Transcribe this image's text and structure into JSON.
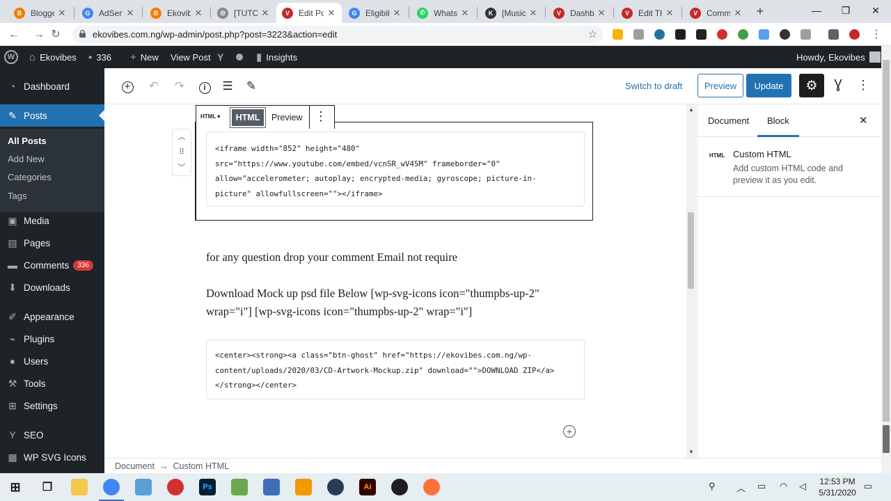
{
  "browser": {
    "tabs": [
      {
        "label": "Blogger",
        "color": "#f57c00",
        "glyph": "B"
      },
      {
        "label": "AdSense",
        "color": "#4285f4",
        "glyph": "G"
      },
      {
        "label": "Ekovibes",
        "color": "#f57c00",
        "glyph": "B"
      },
      {
        "label": "[TUTORIAL]",
        "color": "#888888",
        "glyph": "◎"
      },
      {
        "label": "Edit Post",
        "color": "#c62828",
        "glyph": "V"
      },
      {
        "label": "Eligibility",
        "color": "#4285f4",
        "glyph": "G"
      },
      {
        "label": "WhatsApp",
        "color": "#25d366",
        "glyph": "✆"
      },
      {
        "label": "[Music]",
        "color": "#333333",
        "glyph": "K"
      },
      {
        "label": "Dashboard",
        "color": "#c62828",
        "glyph": "V"
      },
      {
        "label": "Edit Theme",
        "color": "#c62828",
        "glyph": "V"
      },
      {
        "label": "Comments",
        "color": "#c62828",
        "glyph": "V"
      }
    ],
    "active_tab_index": 4,
    "url": "ekovibes.com.ng/wp-admin/post.php?post=3223&action=edit"
  },
  "adminbar": {
    "site_name": "Ekovibes",
    "comments_count": "336",
    "new_label": "New",
    "view_post_label": "View Post",
    "insights_label": "Insights",
    "howdy": "Howdy, Ekovibes"
  },
  "menu": {
    "dashboard": "Dashboard",
    "posts": "Posts",
    "sub": {
      "all": "All Posts",
      "add": "Add New",
      "cats": "Categories",
      "tags": "Tags"
    },
    "media": "Media",
    "pages": "Pages",
    "comments": "Comments",
    "comments_badge": "336",
    "downloads": "Downloads",
    "appearance": "Appearance",
    "plugins": "Plugins",
    "users": "Users",
    "tools": "Tools",
    "settings": "Settings",
    "seo": "SEO",
    "wpsvg": "WP SVG Icons"
  },
  "editor": {
    "switch_to_draft": "Switch to draft",
    "preview": "Preview",
    "update": "Update",
    "block_type_short": "HTML ▾",
    "html_tab": "HTML",
    "preview_tab": "Preview",
    "code_block_1": "<iframe width=\"852\" height=\"480\"\nsrc=\"https://www.youtube.com/embed/vcnSR_wV4SM\" frameborder=\"0\"\nallow=\"accelerometer; autoplay; encrypted-media; gyroscope; picture-in-\npicture\" allowfullscreen=\"\"></iframe>",
    "paragraph_1": "for any question drop your comment Email not require",
    "paragraph_2": "Download Mock up psd file Below  [wp-svg-icons icon=\"thumpbs-up-2\" wrap=\"i\"]  [wp-svg-icons icon=\"thumpbs-up-2\" wrap=\"i\"]",
    "code_block_2": "<center><strong><a class=\"btn-ghost\" href=\"https://ekovibes.com.ng/wp-\ncontent/uploads/2020/03/CD-Artwork-Mockup.zip\" download=\"\">DOWNLOAD ZIP</a>\n</strong></center>"
  },
  "sidebar": {
    "tab_document": "Document",
    "tab_block": "Block",
    "block_icon": "HTML",
    "block_title": "Custom HTML",
    "block_desc": "Add custom HTML code and preview it as you edit."
  },
  "breadcrumb": {
    "root": "Document",
    "arrow": "→",
    "current": "Custom HTML"
  },
  "taskbar": {
    "time": "12:53 PM",
    "date": "5/31/2020"
  }
}
